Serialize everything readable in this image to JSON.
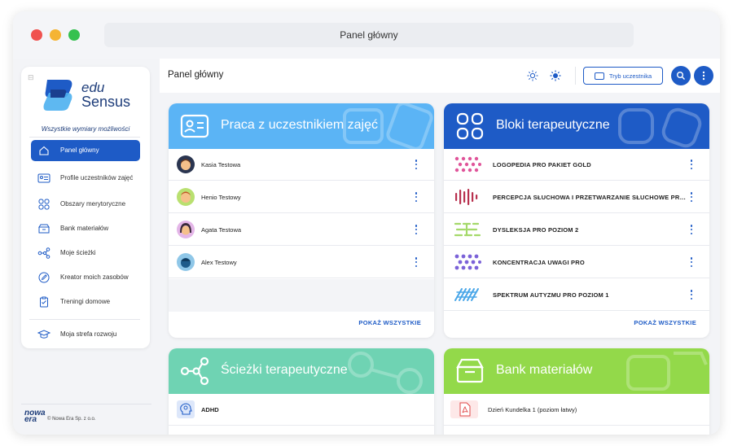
{
  "window": {
    "title": "Panel główny"
  },
  "sidebar": {
    "logo_edu": "edu",
    "logo_sensus": "Sensus",
    "tagline": "Wszystkie wymiary możliwości",
    "items": [
      {
        "label": "Panel główny",
        "icon": "home-icon",
        "active": true
      },
      {
        "label": "Profile uczestników zajęć",
        "icon": "id-card-icon",
        "active": false
      },
      {
        "label": "Obszary merytoryczne",
        "icon": "grid-icon",
        "active": false
      },
      {
        "label": "Bank materiałów",
        "icon": "box-icon",
        "active": false
      },
      {
        "label": "Moje ścieżki",
        "icon": "path-icon",
        "active": false
      },
      {
        "label": "Kreator moich zasobów",
        "icon": "pencil-icon",
        "active": false
      },
      {
        "label": "Treningi domowe",
        "icon": "clipboard-icon",
        "active": false
      }
    ],
    "extra_item": {
      "label": "Moja strefa rozwoju",
      "icon": "graduation-cap-icon"
    },
    "footer_logo_1": "nowa",
    "footer_logo_2": "era",
    "footer_text": "© Nowa Era Sp. z o.o."
  },
  "header": {
    "title": "Panel główny",
    "mode_button": "Tryb uczestnika"
  },
  "cards": {
    "participants": {
      "title": "Praca z uczestnikiem zajęć",
      "color": "#5bb4f5",
      "rows": [
        "Kasia Testowa",
        "Henio Testowy",
        "Agata Testowa",
        "Alex Testowy"
      ],
      "show_all": "POKAŻ WSZYSTKIE"
    },
    "blocks": {
      "title": "Bloki terapeutyczne",
      "color": "#1e5bc6",
      "rows": [
        {
          "label": "LOGOPEDIA PRO PAKIET GOLD",
          "color": "#e0559a"
        },
        {
          "label": "PERCEPCJA SŁUCHOWA I PRZETWARZANIE SŁUCHOWE PRO...",
          "color": "#b8304e"
        },
        {
          "label": "DYSLEKSJA PRO POZIOM 2",
          "color": "#a4d96a"
        },
        {
          "label": "KONCENTRACJA UWAGI PRO",
          "color": "#7b62d8"
        },
        {
          "label": "SPEKTRUM AUTYZMU PRO POZIOM 1",
          "color": "#48a6e8"
        }
      ],
      "show_all": "POKAŻ WSZYSTKIE"
    },
    "paths": {
      "title": "Ścieżki terapeutyczne",
      "color": "#6fd3b3",
      "rows": [
        "ADHD"
      ]
    },
    "bank": {
      "title": "Bank materiałów",
      "color": "#93d94a",
      "rows": [
        "Dzień Kundelka 1 (poziom łatwy)"
      ]
    }
  }
}
